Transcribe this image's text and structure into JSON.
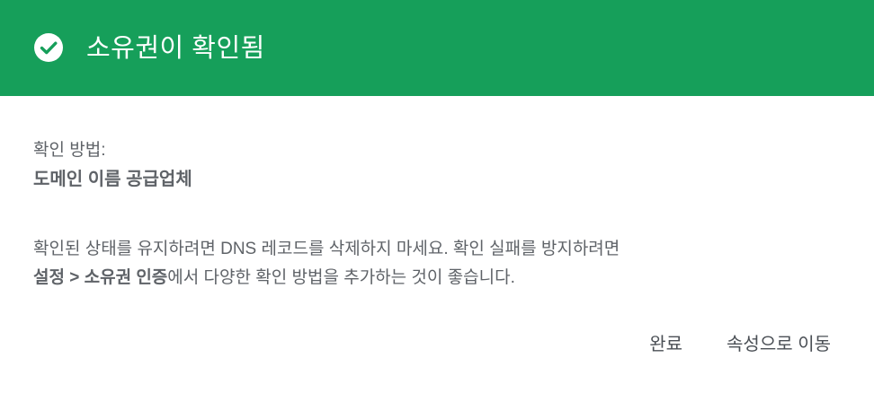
{
  "header": {
    "title": "소유권이 확인됨",
    "icon": "check-circle-icon",
    "background": "#169f5a"
  },
  "method": {
    "label": "확인 방법:",
    "value": "도메인 이름 공급업체"
  },
  "notice": {
    "line1": "확인된 상태를 유지하려면 DNS 레코드를 삭제하지 마세요. 확인 실패를 방지하려면",
    "link_text": "설정 > 소유권 인증",
    "line2_rest": "에서 다양한 확인 방법을 추가하는 것이 좋습니다."
  },
  "actions": {
    "done_label": "완료",
    "goto_label": "속성으로 이동"
  }
}
